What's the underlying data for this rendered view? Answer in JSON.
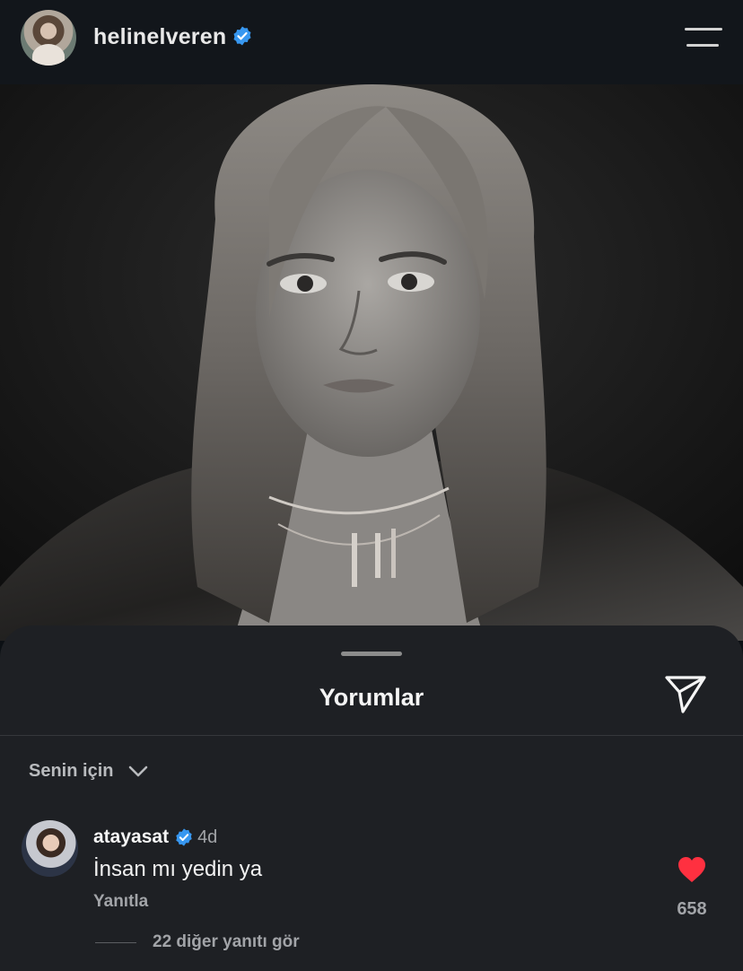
{
  "header": {
    "username": "helinelveren",
    "verified": true,
    "avatar_icon": "profile-photo",
    "menu_icon": "hamburger-menu-icon"
  },
  "post": {
    "image": "black-and-white portrait photo"
  },
  "comments_sheet": {
    "title": "Yorumlar",
    "share_icon": "paper-plane-icon",
    "filter_label": "Senin için",
    "filter_icon": "chevron-down-icon"
  },
  "comments": [
    {
      "username": "atayasat",
      "verified": true,
      "time": "4d",
      "text": "İnsan mı yedin ya",
      "reply_label": "Yanıtla",
      "likes": "658",
      "liked": true,
      "more_replies": "22 diğer yanıtı gör"
    }
  ],
  "colors": {
    "background": "#0c1014",
    "sheet": "#1e2024",
    "verified_blue": "#3797f0",
    "like_red": "#ff3040",
    "secondary_text": "#a2a4a8"
  }
}
